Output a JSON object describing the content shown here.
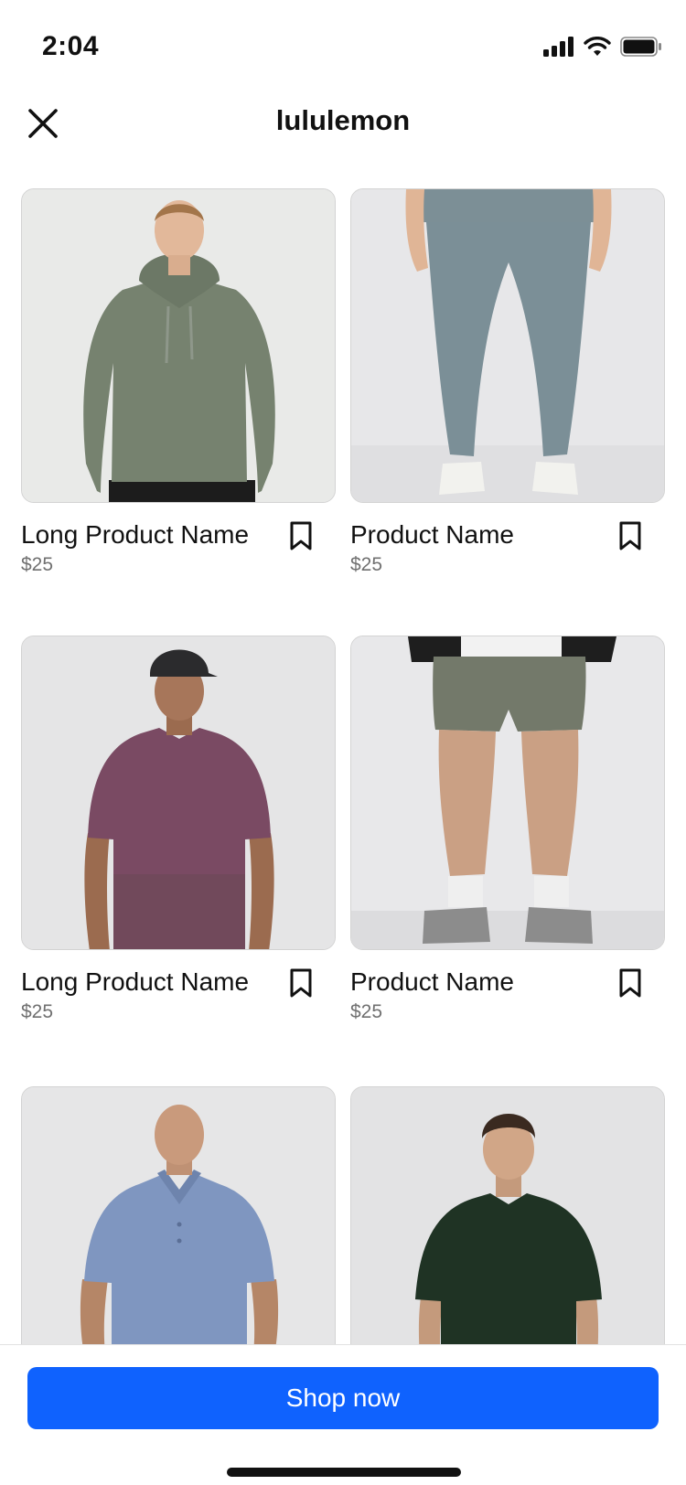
{
  "status_bar": {
    "time": "2:04"
  },
  "header": {
    "title": "lululemon",
    "close_icon": "close-icon"
  },
  "products": [
    {
      "name": "Long Product Name",
      "price": "$25",
      "image": "green hoodie"
    },
    {
      "name": "Product Name",
      "price": "$25",
      "image": "grey joggers"
    },
    {
      "name": "Long Product Name",
      "price": "$25",
      "image": "purple t-shirt"
    },
    {
      "name": "Product Name",
      "price": "$25",
      "image": "green shorts"
    },
    {
      "name": "",
      "price": "",
      "image": "blue polo"
    },
    {
      "name": "",
      "price": "",
      "image": "dark green t-shirt"
    }
  ],
  "footer": {
    "cta_label": "Shop now"
  },
  "colors": {
    "accent": "#0f62fe",
    "price_text": "#707070",
    "card_border": "#d3d3d3"
  }
}
